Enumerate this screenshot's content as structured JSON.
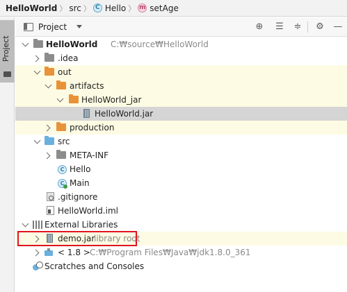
{
  "breadcrumb": {
    "project": "HelloWorld",
    "folder": "src",
    "class_icon": "C",
    "class": "Hello",
    "method_icon": "m",
    "method": "setAge"
  },
  "stripe": {
    "label": "Project"
  },
  "panel": {
    "title": "Project"
  },
  "tree": {
    "root": {
      "label": "HelloWorld",
      "path": "C:₩source₩HelloWorld"
    },
    "idea": ".idea",
    "out": "out",
    "artifacts": "artifacts",
    "hello_world_jar_folder": "HelloWorld_jar",
    "hello_world_jar": "HelloWorld.jar",
    "production": "production",
    "src": "src",
    "meta_inf": "META-INF",
    "hello": "Hello",
    "main": "Main",
    "hello_icon": "C",
    "main_icon": "C",
    "gitignore": ".gitignore",
    "iml": "HelloWorld.iml",
    "external_libraries": "External Libraries",
    "demo_jar": "demo.jar",
    "demo_jar_hint": "library root",
    "jdk": "< 1.8 >",
    "jdk_path": "C:₩Program Files₩Java₩jdk1.8.0_361",
    "scratches": "Scratches and Consoles"
  },
  "colors": {
    "highlight_row": "#fdfbe3",
    "selected_row": "#d5d5d5",
    "callout_border": "#e0141e",
    "folder_orange": "#e8923a",
    "folder_blue": "#6ab0de"
  }
}
